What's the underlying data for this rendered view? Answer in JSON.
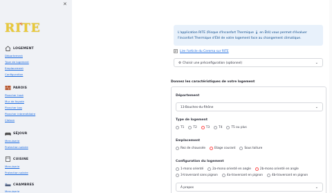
{
  "sidebar": {
    "close_icon": "close-icon",
    "logo_text": "RITE",
    "sections": [
      {
        "label": "LOGEMENT",
        "icon": "house-icon",
        "links": [
          "Département",
          "Type de logement",
          "Emplacement",
          "Configuration"
        ]
      },
      {
        "label": "PAROIS",
        "icon": "bricks-icon",
        "links": [
          "Plancher haut",
          "Mur de façade",
          "Plancher bas",
          "Plancher intermédiaire",
          "Cloison"
        ]
      },
      {
        "label": "SÉJOUR",
        "icon": "sofa-icon",
        "links": [
          "Menuiserie",
          "Protection solaire"
        ]
      },
      {
        "label": "CUISINE",
        "icon": "cooker-icon",
        "links": [
          "Menuiserie",
          "Protection solaire"
        ]
      },
      {
        "label": "CHAMBRES",
        "icon": "bed-icon",
        "links": [
          "Menuiserie"
        ]
      }
    ]
  },
  "main": {
    "info_text": "L'application RITE (Risque d'Inconfort Thermique 🌡 en Été) vous permet d'évaluer l'inconfort Thermique d'Été de votre logement face au changement climatique.",
    "article_link": "Lire l'article du Cerema sur RITE",
    "preconfig_placeholder": "Choisir une préconfiguration (optionnel)",
    "section_title": "Donnez les caractéristiques de votre logement",
    "departement": {
      "label": "Département",
      "value": "13-Bouches-du-Rhône"
    },
    "type_logement": {
      "label": "Type de logement",
      "options": [
        "T1",
        "T2",
        "T3",
        "T4",
        "T5 ou plus"
      ],
      "selected": "T3"
    },
    "emplacement": {
      "label": "Emplacement",
      "options": [
        "Rez de chaussée",
        "Etage courant",
        "Sous toiture"
      ],
      "selected": "Etage courant"
    },
    "configuration": {
      "label": "Configuration du logement",
      "options_row1": [
        "1-mono orienté",
        "2a-mono orienté en angle",
        "2b-mono orienté en angle"
      ],
      "options_row2": [
        "3-traversant sans pignon",
        "4a-traversant en pignon",
        "4b-traversant en pignon"
      ],
      "selected": "2b-mono orienté en angle"
    },
    "apropos": "À propos"
  }
}
